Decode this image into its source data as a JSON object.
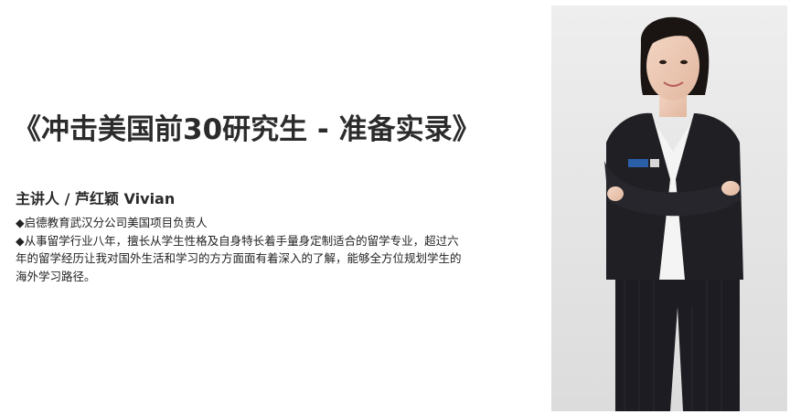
{
  "title": "《冲击美国前30研究生 - 准备实录》",
  "speaker": "主讲人 / 芦红颖 Vivian",
  "bio": [
    "◆启德教育武汉分公司美国项目负责人",
    "◆从事留学行业八年，擅长从学生性格及自身特长着手量身定制适合的留学专业，超过六",
    "年的留学经历让我对国外生活和学习的方方面面有着深入的了解，能够全方位规划学生的",
    "海外学习路径。"
  ],
  "photo": {
    "icon": "speaker-portrait",
    "background": "#e6e6e6",
    "suit_color": "#1f1f24",
    "shirt_color": "#f4f4f4",
    "badge_color": "#2a5fa8"
  }
}
